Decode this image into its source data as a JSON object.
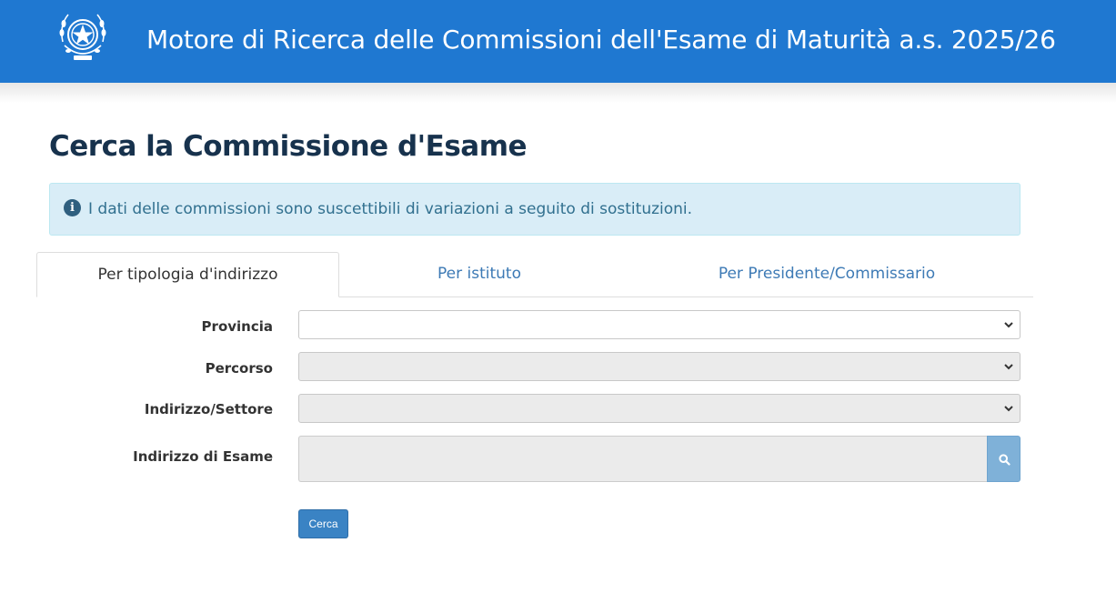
{
  "header": {
    "title": "Motore di Ricerca delle Commissioni dell'Esame di Maturità a.s. 2025/26",
    "emblem_icon": "italian-republic-emblem-icon",
    "background_color": "#1f78d1"
  },
  "page": {
    "title": "Cerca la Commissione d'Esame"
  },
  "alert": {
    "icon": "info-icon",
    "text": "I dati delle commissioni sono suscettibili di variazioni a seguito di sostituzioni."
  },
  "tabs": [
    {
      "label": "Per tipologia d'indirizzo",
      "active": true
    },
    {
      "label": "Per istituto",
      "active": false
    },
    {
      "label": "Per Presidente/Commissario",
      "active": false
    }
  ],
  "form": {
    "fields": [
      {
        "label": "Provincia",
        "value": "",
        "disabled": false
      },
      {
        "label": "Percorso",
        "value": "",
        "disabled": true
      },
      {
        "label": "Indirizzo/Settore",
        "value": "",
        "disabled": true
      },
      {
        "label": "Indirizzo di Esame",
        "value": "",
        "disabled": true
      }
    ],
    "search_icon": "search-icon",
    "submit_label": "Cerca"
  }
}
